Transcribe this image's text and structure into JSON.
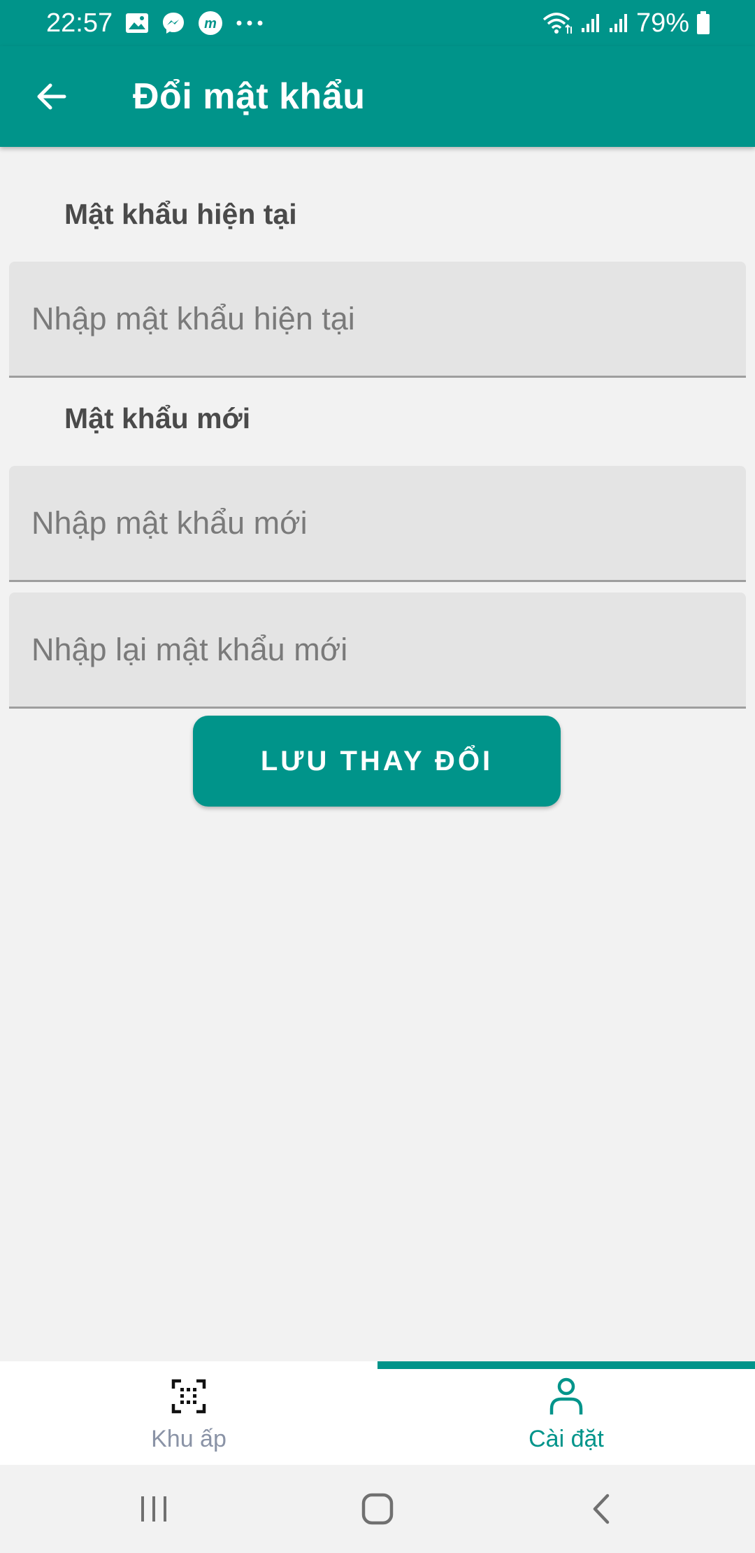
{
  "status_bar": {
    "time": "22:57",
    "notification_icons": [
      "image-icon",
      "messenger-icon",
      "m-app-icon",
      "more-dots-icon"
    ],
    "battery": "79%"
  },
  "app_bar": {
    "title": "Đổi mật khẩu",
    "back_icon": "arrow-left-icon"
  },
  "form": {
    "current_password": {
      "label": "Mật khẩu hiện tại",
      "placeholder": "Nhập mật khẩu hiện tại",
      "value": ""
    },
    "new_password": {
      "label": "Mật khẩu mới",
      "placeholder": "Nhập mật khẩu mới",
      "value": ""
    },
    "confirm_password": {
      "placeholder": "Nhập lại mật khẩu mới",
      "value": ""
    },
    "save_label": "LƯU THAY ĐỔI"
  },
  "bottom_nav": {
    "items": [
      {
        "label": "Khu ấp",
        "icon": "qr-scan-icon",
        "active": false
      },
      {
        "label": "Cài đặt",
        "icon": "person-icon",
        "active": true
      }
    ]
  },
  "colors": {
    "primary": "#00948a",
    "background": "#f2f2f2",
    "field_bg": "#e4e4e4",
    "inactive_nav": "#8a93a6"
  }
}
